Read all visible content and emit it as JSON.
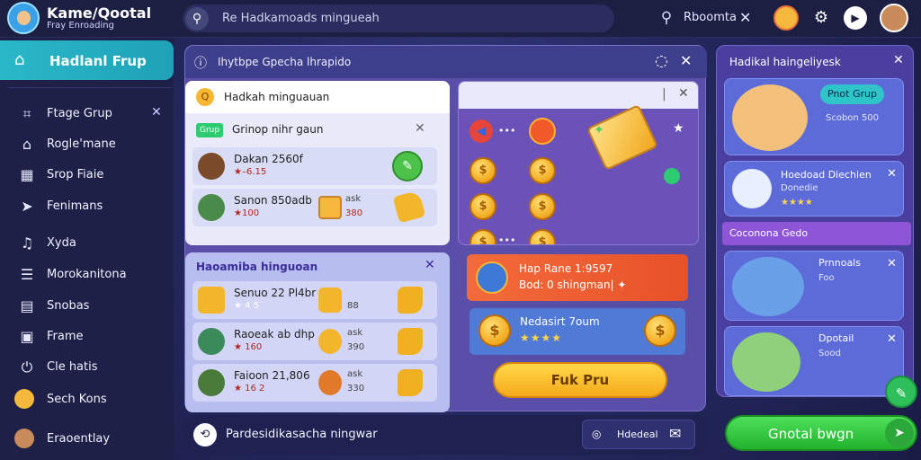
{
  "app": {
    "title": "Kame/Qootal",
    "subtitle": "Fray Enroading",
    "search_placeholder": "Re Hadkamoads mingueah",
    "search_label": "Rboomta",
    "close_glyph": "✕"
  },
  "sidebar": {
    "active_label": "Hadlanl Frup",
    "items": [
      {
        "label": "Ftage Grup",
        "icon": "tag-icon"
      },
      {
        "label": "Rogle'mane",
        "icon": "home-icon"
      },
      {
        "label": "Srop Fiaie",
        "icon": "store-icon"
      },
      {
        "label": "Fenimans",
        "icon": "send-icon"
      },
      {
        "label": "Xyda",
        "icon": "music-icon"
      },
      {
        "label": "Morokanitona",
        "icon": "list-icon"
      },
      {
        "label": "Snobas",
        "icon": "notes-icon"
      },
      {
        "label": "Frame",
        "icon": "frame-icon"
      },
      {
        "label": "Cle hatis",
        "icon": "power-icon"
      },
      {
        "label": "Sech Kons",
        "icon": "mascot-icon"
      },
      {
        "label": "Eraoentlay",
        "icon": "avatar-icon"
      }
    ]
  },
  "main": {
    "header_label": "Ihytbpe Gpecha lhrapido",
    "white_card": {
      "title": "Hadkah minguauan",
      "tag": "Grup",
      "subtitle": "Grinop nihr gaun",
      "rows": [
        {
          "name": "Dakan 2560f",
          "stat": "★–6.15",
          "mid1": "",
          "mid2": ""
        },
        {
          "name": "Sanon 850adb",
          "stat": "★100",
          "mid1": "ask",
          "mid2": "380"
        }
      ]
    },
    "lavender_card": {
      "title": "Haoamiba hinguoan",
      "rows": [
        {
          "name": "Senuo 22 Pl4br",
          "stat": "★ 4 5",
          "mid1": "",
          "mid2": "88"
        },
        {
          "name": "Raoeak ab dhp",
          "stat": "★ 160",
          "mid1": "ask",
          "mid2": "390"
        },
        {
          "name": "Faioon 21,806",
          "stat": "★ 16 2",
          "mid1": "ask",
          "mid2": "330"
        }
      ]
    },
    "purple_card": {
      "bar_glyph": "|"
    },
    "promo_orange": {
      "line1": "Hap Rane 1:9597",
      "line2": "Bod: 0 shingman| ✦"
    },
    "promo_blue": {
      "line1": "Nedasirt 7oum",
      "line2": "★★★★"
    },
    "cta_label": "Fuk Pru"
  },
  "bottom_bar": {
    "label": "Pardesidikasacha ningwar",
    "chip_label": "Hdedeal"
  },
  "right_panel": {
    "title": "Hadikal haingeliyesk",
    "cards": [
      {
        "pill": "Pnot Grup",
        "line1": "",
        "line2": "Scobon 500"
      },
      {
        "line1": "Hoedoad Diechien",
        "line2": "Donedie"
      },
      {
        "line1": "Prnnoals",
        "line2": "Foo"
      },
      {
        "line1": "Dpotail",
        "line2": "Sood"
      }
    ],
    "card2_stars": "★★★★",
    "section_label": "Coconona Gedo"
  },
  "green_button": {
    "label": "Gnotal bwgn"
  },
  "colors": {
    "accent_teal": "#2ab8c8",
    "accent_green": "#2ecc71",
    "accent_yellow": "#ffd84a",
    "panel_purple": "#5a4fa8"
  }
}
